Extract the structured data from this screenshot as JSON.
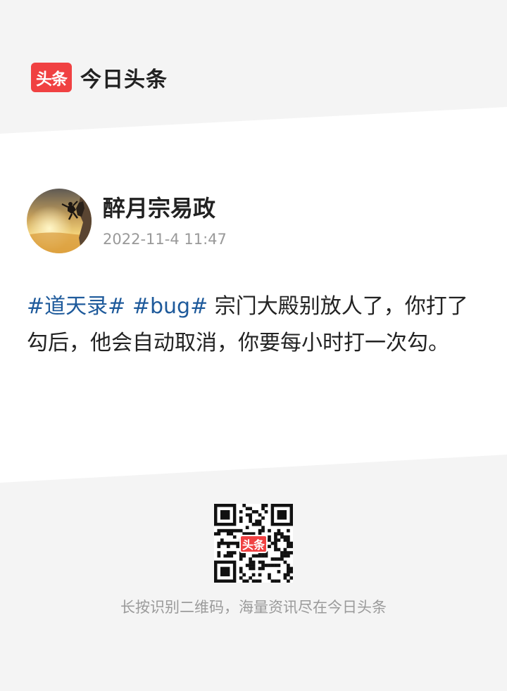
{
  "brand": {
    "logo_text": "头条",
    "name": "今日头条",
    "accent": "#f04142"
  },
  "author": {
    "name": "醉月宗易政",
    "time": "2022-11-4 11:47"
  },
  "post": {
    "tags": [
      "#道天录#",
      "#bug#"
    ],
    "text": "宗门大殿别放人了，你打了勾后，他会自动取消，你要每小时打一次勾。",
    "tag_color": "#1e5a9b"
  },
  "footer": {
    "qr_logo_text": "头条",
    "caption": "长按识别二维码，海量资讯尽在今日头条"
  }
}
